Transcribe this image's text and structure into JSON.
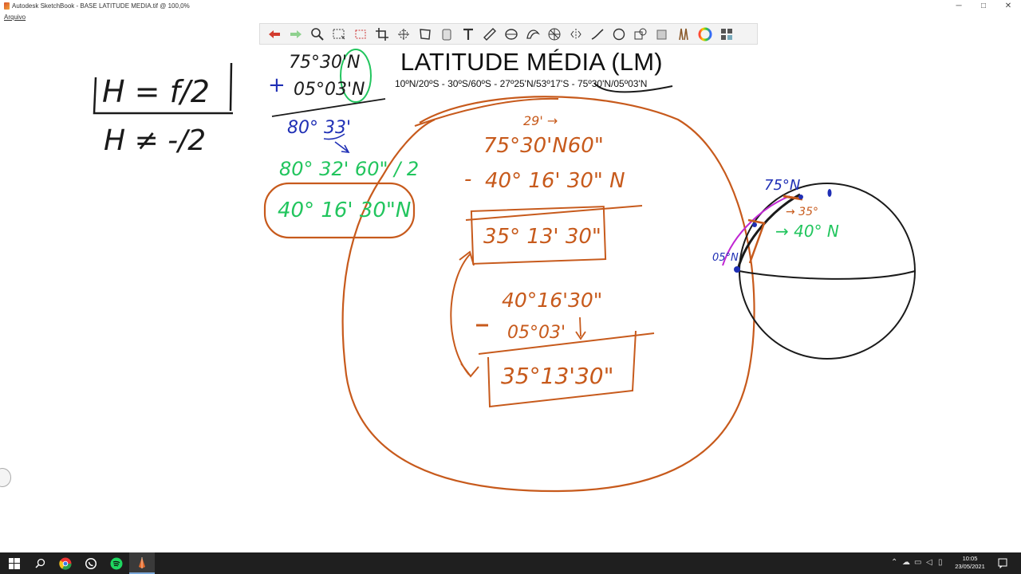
{
  "window": {
    "title": "Autodesk SketchBook - BASE LATITUDE MEDIA.tif @ 100,0%",
    "controls": {
      "minimize": "─",
      "maximize": "□",
      "close": "✕"
    }
  },
  "menu": {
    "items": [
      "Arquivo"
    ]
  },
  "toolbar": {
    "tools": [
      "undo-icon",
      "redo-icon",
      "zoom-icon",
      "select-icon",
      "lasso-select-icon",
      "crop-icon",
      "transform-icon",
      "distort-icon",
      "bucket-fill-icon",
      "text-icon",
      "ruler-icon",
      "ellipse-guide-icon",
      "french-curve-icon",
      "perspective-icon",
      "symmetry-icon",
      "line-icon",
      "circle-icon",
      "shape-icon",
      "copic-icon",
      "brush-palette-icon",
      "color-wheel-icon",
      "color-puck-icon"
    ]
  },
  "document": {
    "title": "LATITUDE MÉDIA (LM)",
    "subtitle": "10ºN/20ºS - 30ºS/60ºS - 27º25'N/53º17'S - 75º30'N/05º03'N"
  },
  "annotations": {
    "formula_top": "H = f/2",
    "formula_bottom": "H ≠ -/2",
    "sum_line1": "75°30'N",
    "sum_line2": "05°03'N",
    "sum_result": "80° 33'",
    "half_green": "80° 32' 60\" / 2",
    "lm_green": "40° 16' 30\"N",
    "borrow_note": "29' →",
    "sub_top": "75°30'N60\"",
    "sub_bottom": "40° 16' 30\" N",
    "sub_result": "35° 13' 30\"",
    "check_top": "40°16'30\"",
    "check_bottom": "05°03'",
    "check_result": "35°13'30\"",
    "globe_75": "75°N",
    "globe_35": "→ 35°",
    "globe_40": "→ 40° N",
    "globe_05": "05°N"
  },
  "colors": {
    "black_ink": "#1a1a1a",
    "blue_ink": "#1f2fb5",
    "green_ink": "#22c55e",
    "orange_ink": "#c75a1c",
    "magenta_ink": "#c026d3"
  },
  "taskbar": {
    "apps": [
      "windows-start-icon",
      "search-icon",
      "chrome-icon",
      "whatsapp-icon",
      "spotify-icon",
      "sketchbook-icon"
    ],
    "clock_time": "10:05",
    "clock_date": "23/05/2021"
  }
}
